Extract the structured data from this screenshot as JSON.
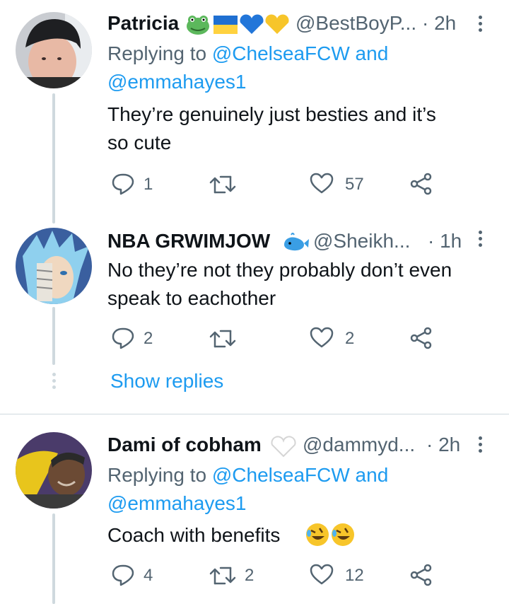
{
  "tweets": [
    {
      "name": "Patricia",
      "handle": "@BestBoyP...",
      "time": "· 2h",
      "replying_prefix": "Replying to ",
      "replying_user1": "@ChelseaFCW",
      "replying_and": " and",
      "replying_user2": "@emmahayes1",
      "text_line1": "They’re genuinely just besties and it’s",
      "text_line2": "so cute",
      "reply_count": "1",
      "retweet_count": "",
      "like_count": "57"
    },
    {
      "name": "NBA GRWIMJOW",
      "handle": "@Sheikh...",
      "time": "· 1h",
      "text_line1": "No they’re not they probably don’t even",
      "text_line2": "speak to eachother",
      "reply_count": "2",
      "retweet_count": "",
      "like_count": "2"
    },
    {
      "name": "Dami of cobham",
      "handle": "@dammyd...",
      "time": "· 2h",
      "replying_prefix": "Replying to ",
      "replying_user1": "@ChelseaFCW",
      "replying_and": " and",
      "replying_user2": "@emmahayes1",
      "text_line1": "Coach with benefits",
      "reply_count": "4",
      "retweet_count": "2",
      "like_count": "12"
    }
  ],
  "show_replies_label": "Show replies",
  "icons": [
    "frog-emoji",
    "ukraine-flag-emoji",
    "blue-heart-emoji",
    "yellow-heart-emoji",
    "whale-emoji",
    "white-heart-emoji",
    "rolling-laughing-emoji",
    "reply-icon",
    "retweet-icon",
    "like-icon",
    "share-icon",
    "more-icon"
  ],
  "colors": {
    "link": "#1d9bf0",
    "secondary": "#536471",
    "line": "#cfd9de"
  }
}
